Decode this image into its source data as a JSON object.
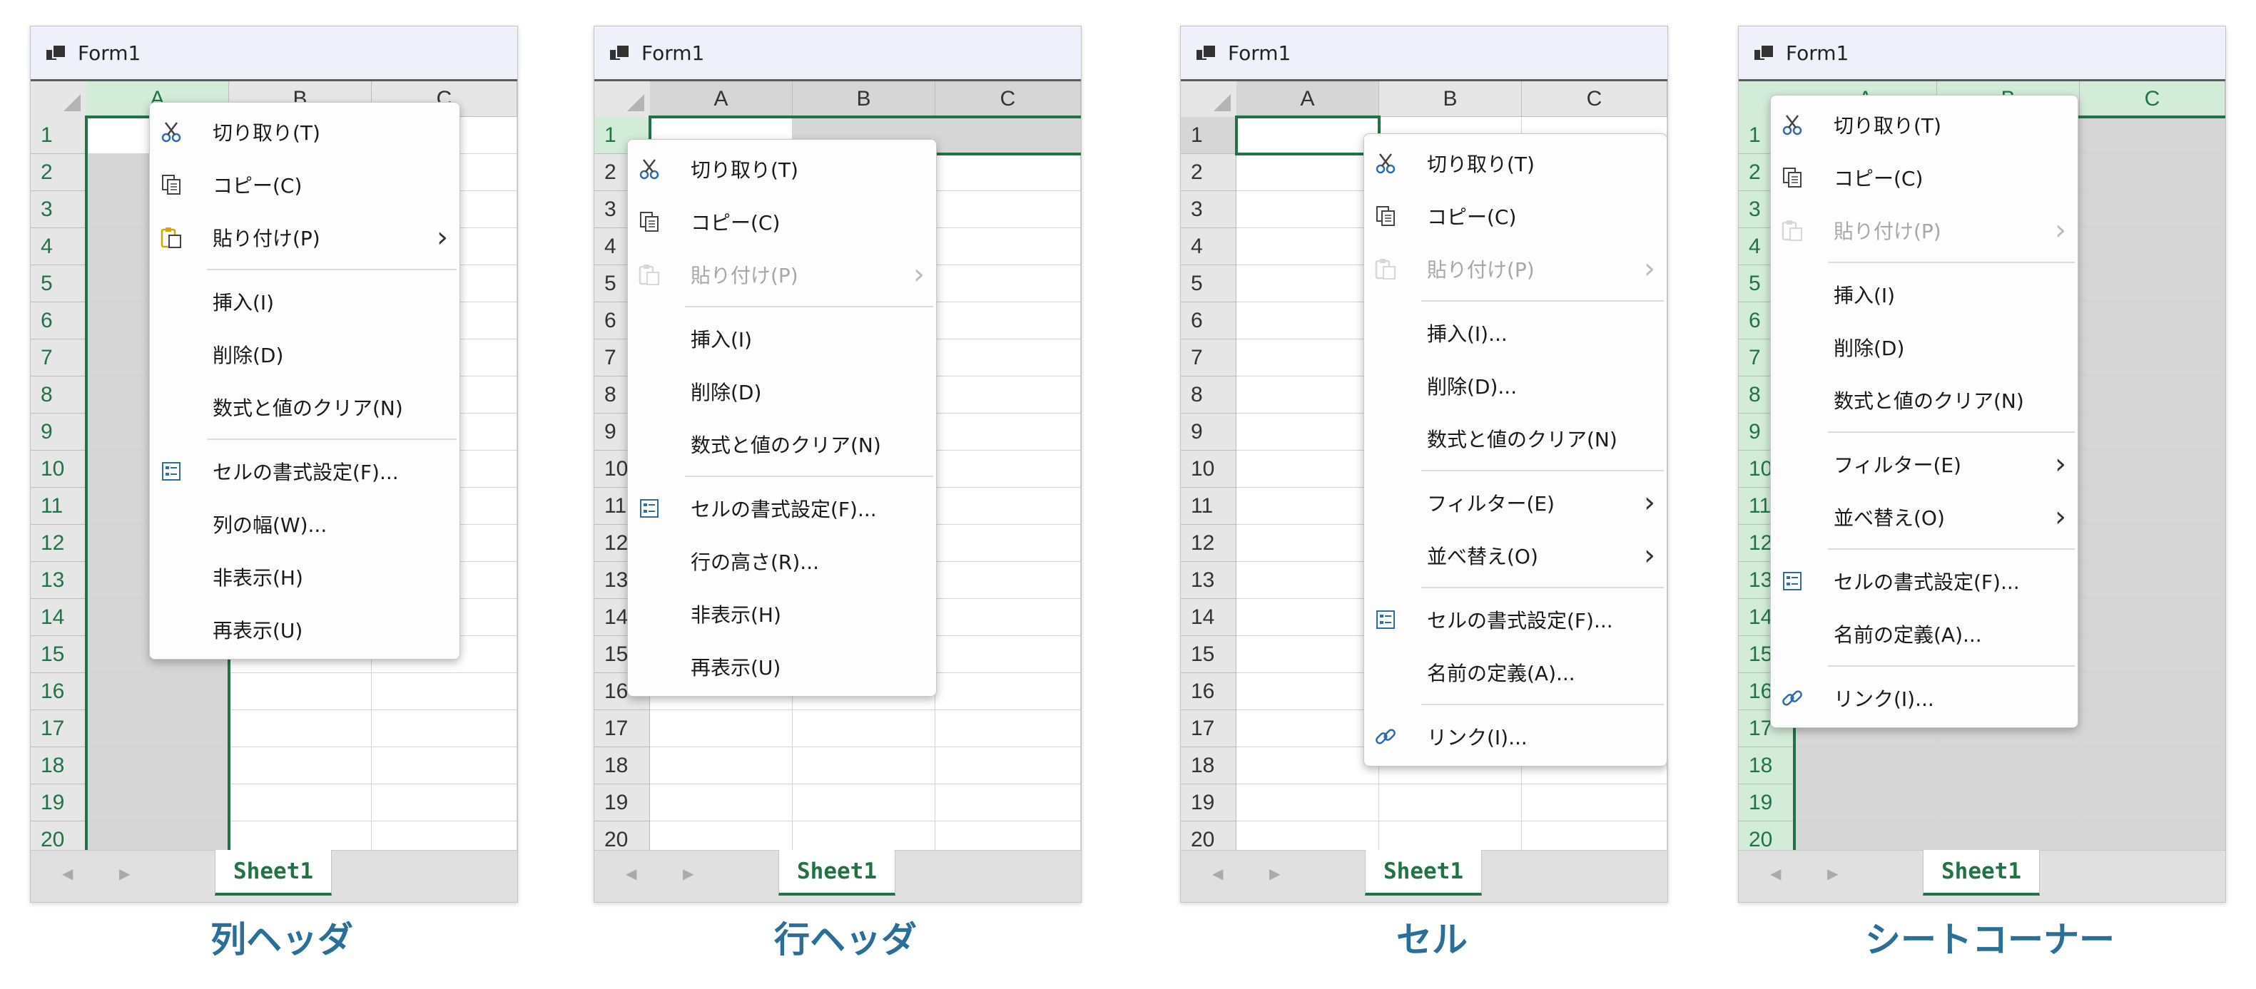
{
  "window_title": "Form1",
  "grid": {
    "columns": [
      "A",
      "B",
      "C"
    ],
    "rows": [
      "1",
      "2",
      "3",
      "4",
      "5",
      "6",
      "7",
      "8",
      "9",
      "10",
      "11",
      "12",
      "13",
      "14",
      "15",
      "16",
      "17",
      "18",
      "19",
      "20"
    ]
  },
  "sheet_tab": "Sheet1",
  "nav": {
    "prev": "◀",
    "next": "▶"
  },
  "accent_color": "#217346",
  "caption_color": "#2a6f97",
  "panels": [
    {
      "caption": "列ヘッダ",
      "menu": [
        {
          "type": "item",
          "label": "切り取り(T)",
          "icon": "scissors-icon"
        },
        {
          "type": "item",
          "label": "コピー(C)",
          "icon": "copy-icon"
        },
        {
          "type": "item",
          "label": "貼り付け(P)",
          "icon": "paste-icon",
          "submenu": true
        },
        {
          "type": "sep"
        },
        {
          "type": "item",
          "label": "挿入(I)"
        },
        {
          "type": "item",
          "label": "削除(D)"
        },
        {
          "type": "item",
          "label": "数式と値のクリア(N)"
        },
        {
          "type": "sep"
        },
        {
          "type": "item",
          "label": "セルの書式設定(F)...",
          "icon": "format-cells-icon"
        },
        {
          "type": "item",
          "label": "列の幅(W)..."
        },
        {
          "type": "item",
          "label": "非表示(H)"
        },
        {
          "type": "item",
          "label": "再表示(U)"
        }
      ]
    },
    {
      "caption": "行ヘッダ",
      "menu": [
        {
          "type": "item",
          "label": "切り取り(T)",
          "icon": "scissors-icon"
        },
        {
          "type": "item",
          "label": "コピー(C)",
          "icon": "copy-icon"
        },
        {
          "type": "item",
          "label": "貼り付け(P)",
          "icon": "paste-icon",
          "submenu": true,
          "disabled": true
        },
        {
          "type": "sep"
        },
        {
          "type": "item",
          "label": "挿入(I)"
        },
        {
          "type": "item",
          "label": "削除(D)"
        },
        {
          "type": "item",
          "label": "数式と値のクリア(N)"
        },
        {
          "type": "sep"
        },
        {
          "type": "item",
          "label": "セルの書式設定(F)...",
          "icon": "format-cells-icon"
        },
        {
          "type": "item",
          "label": "行の高さ(R)..."
        },
        {
          "type": "item",
          "label": "非表示(H)"
        },
        {
          "type": "item",
          "label": "再表示(U)"
        }
      ]
    },
    {
      "caption": "セル",
      "menu": [
        {
          "type": "item",
          "label": "切り取り(T)",
          "icon": "scissors-icon"
        },
        {
          "type": "item",
          "label": "コピー(C)",
          "icon": "copy-icon"
        },
        {
          "type": "item",
          "label": "貼り付け(P)",
          "icon": "paste-icon",
          "submenu": true,
          "disabled": true
        },
        {
          "type": "sep"
        },
        {
          "type": "item",
          "label": "挿入(I)..."
        },
        {
          "type": "item",
          "label": "削除(D)..."
        },
        {
          "type": "item",
          "label": "数式と値のクリア(N)"
        },
        {
          "type": "sep"
        },
        {
          "type": "item",
          "label": "フィルター(E)",
          "submenu": true
        },
        {
          "type": "item",
          "label": "並べ替え(O)",
          "submenu": true
        },
        {
          "type": "sep"
        },
        {
          "type": "item",
          "label": "セルの書式設定(F)...",
          "icon": "format-cells-icon"
        },
        {
          "type": "item",
          "label": "名前の定義(A)..."
        },
        {
          "type": "sep"
        },
        {
          "type": "item",
          "label": "リンク(I)...",
          "icon": "link-icon"
        }
      ]
    },
    {
      "caption": "シートコーナー",
      "menu": [
        {
          "type": "item",
          "label": "切り取り(T)",
          "icon": "scissors-icon"
        },
        {
          "type": "item",
          "label": "コピー(C)",
          "icon": "copy-icon"
        },
        {
          "type": "item",
          "label": "貼り付け(P)",
          "icon": "paste-icon",
          "submenu": true,
          "disabled": true
        },
        {
          "type": "sep"
        },
        {
          "type": "item",
          "label": "挿入(I)"
        },
        {
          "type": "item",
          "label": "削除(D)"
        },
        {
          "type": "item",
          "label": "数式と値のクリア(N)"
        },
        {
          "type": "sep"
        },
        {
          "type": "item",
          "label": "フィルター(E)",
          "submenu": true
        },
        {
          "type": "item",
          "label": "並べ替え(O)",
          "submenu": true
        },
        {
          "type": "sep"
        },
        {
          "type": "item",
          "label": "セルの書式設定(F)...",
          "icon": "format-cells-icon"
        },
        {
          "type": "item",
          "label": "名前の定義(A)..."
        },
        {
          "type": "sep"
        },
        {
          "type": "item",
          "label": "リンク(I)...",
          "icon": "link-icon"
        }
      ]
    }
  ]
}
